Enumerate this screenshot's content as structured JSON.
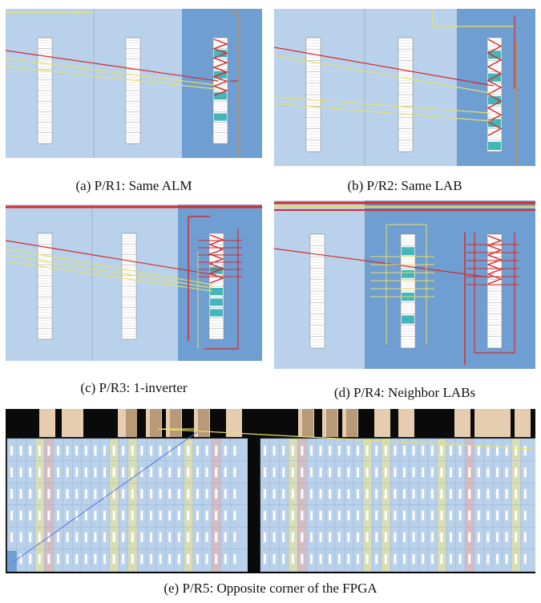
{
  "figure": {
    "subfigures": [
      {
        "id": "a",
        "caption": "(a) P/R1: Same ALM"
      },
      {
        "id": "b",
        "caption": "(b) P/R2: Same LAB"
      },
      {
        "id": "c",
        "caption": "(c) P/R3: 1-inverter"
      },
      {
        "id": "d",
        "caption": "(d) P/R4: Neighbor LABs"
      },
      {
        "id": "e",
        "caption": "(e) P/R5: Opposite corner of the FPGA"
      }
    ]
  },
  "colors": {
    "light_region": "#b9d1ea",
    "dark_region": "#6f9ed2",
    "route_red": "#d42a2a",
    "route_yellow": "#e3e06a",
    "route_blue": "#5a6ee0",
    "cell_teal": "#22aab0",
    "column_tan": "#c8a888"
  }
}
